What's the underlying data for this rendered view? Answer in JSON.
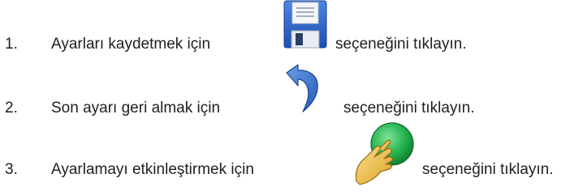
{
  "steps": [
    {
      "number": "1.",
      "text_before": "Ayarları kaydetmek için",
      "icon": "save-floppy-icon",
      "text_after": "seçeneğini tıklayın."
    },
    {
      "number": "2.",
      "text_before": "Son ayarı geri almak için",
      "icon": "undo-arrow-icon",
      "text_after": "seçeneğini tıklayın."
    },
    {
      "number": "3.",
      "text_before": "Ayarlamayı etkinleştirmek için",
      "icon": "finger-press-green-button-icon",
      "text_after": "seçeneğini tıklayın."
    }
  ],
  "colors": {
    "text": "#1f1f1f",
    "floppy_blue": "#2b63c7",
    "undo_blue": "#3a75c9",
    "button_green": "#22b14c",
    "hand_yellow": "#f2c84b"
  }
}
